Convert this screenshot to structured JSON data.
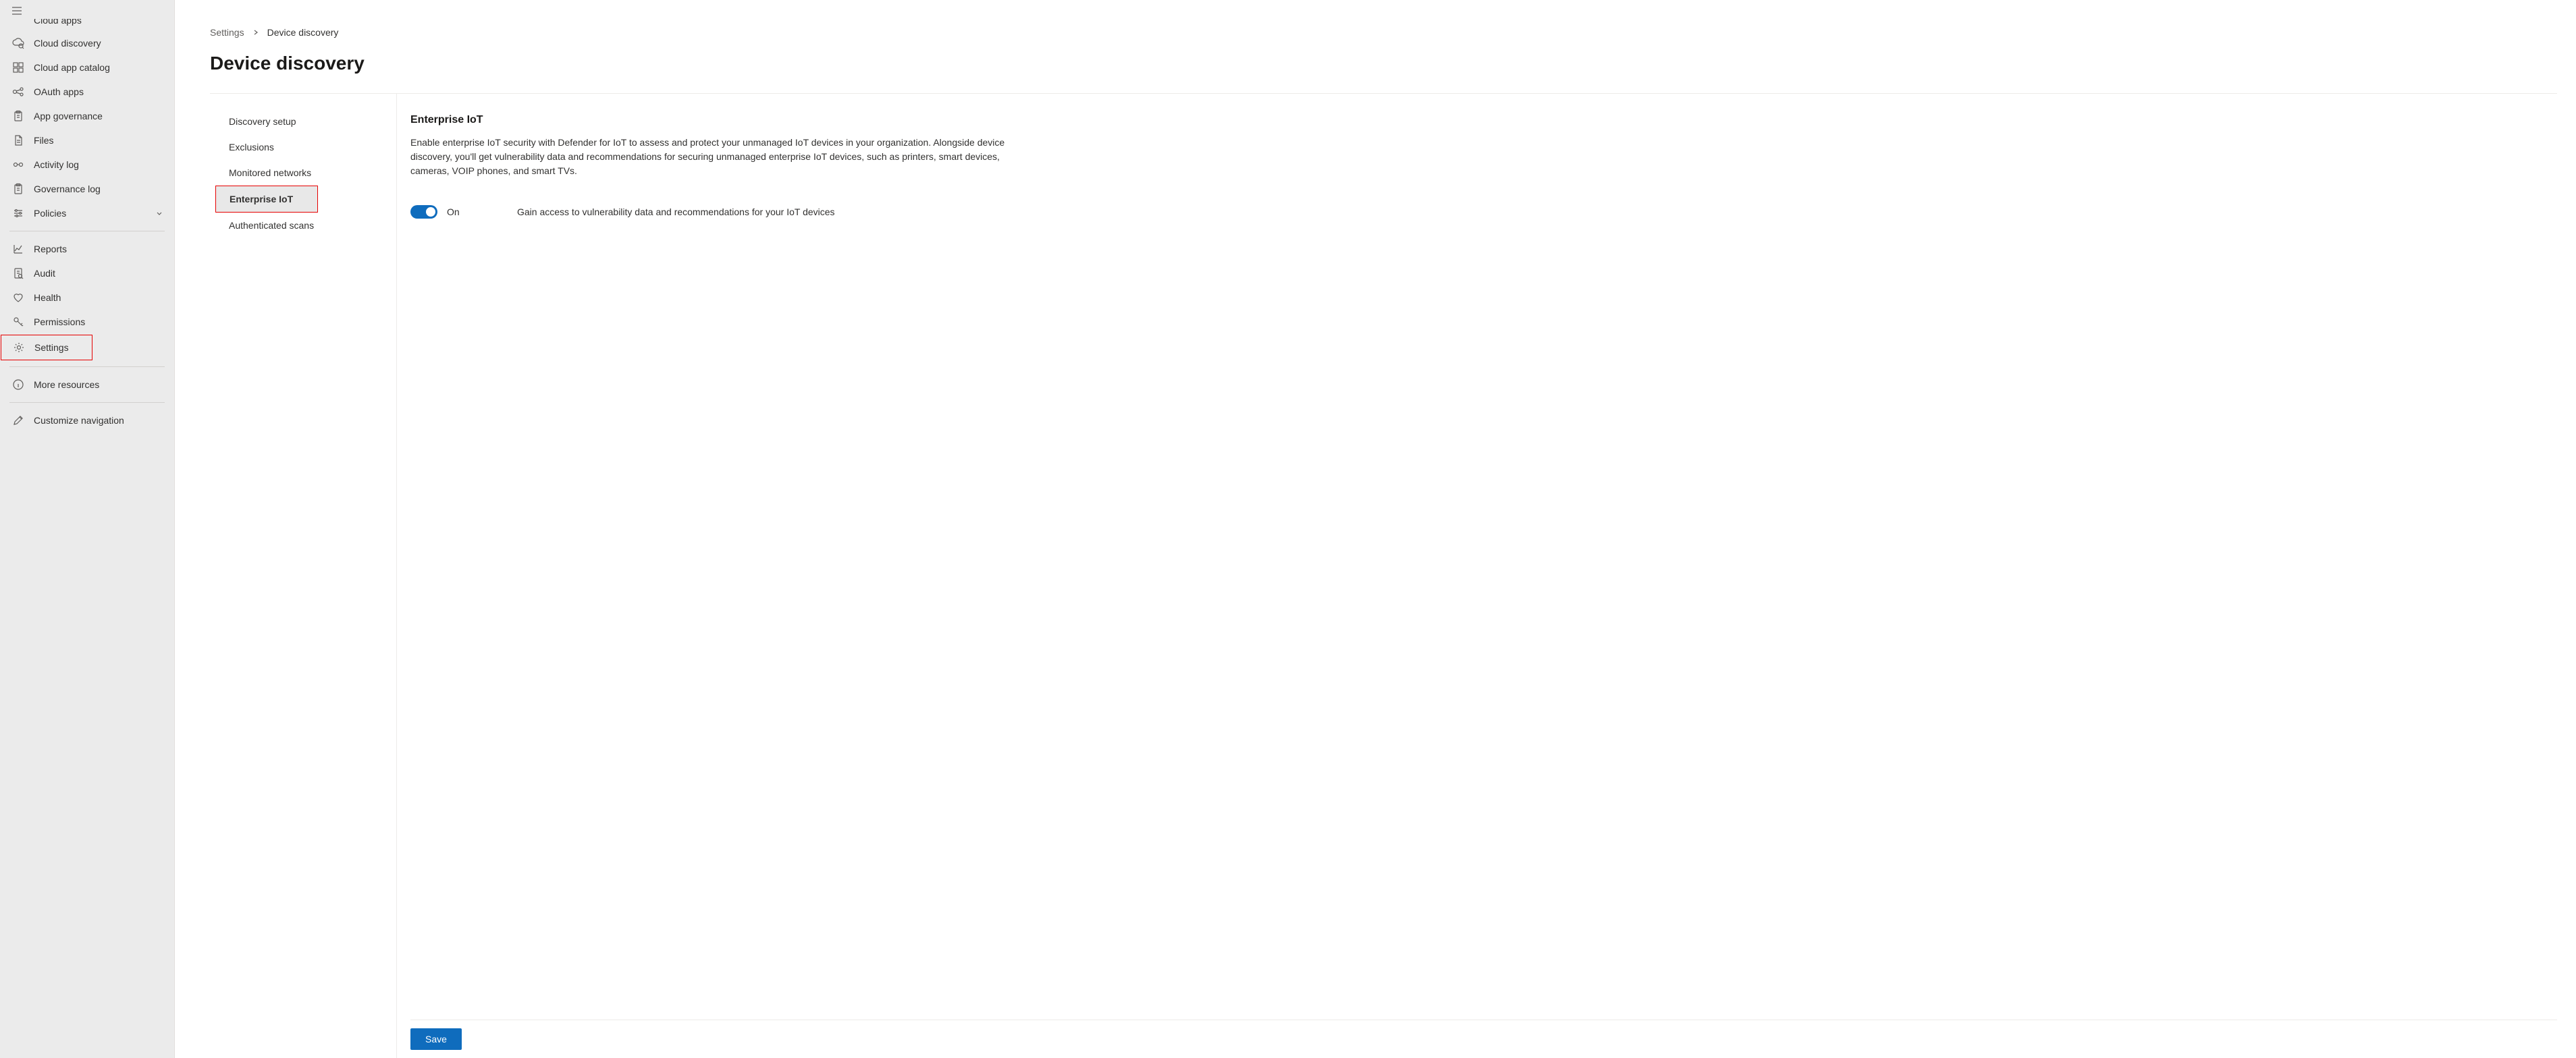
{
  "sidebar": {
    "items": [
      {
        "icon": "cloud-apps",
        "label": "Cloud apps"
      },
      {
        "icon": "cloud-discovery",
        "label": "Cloud discovery"
      },
      {
        "icon": "app-catalog",
        "label": "Cloud app catalog"
      },
      {
        "icon": "oauth",
        "label": "OAuth apps"
      },
      {
        "icon": "clipboard",
        "label": "App governance"
      },
      {
        "icon": "files",
        "label": "Files"
      },
      {
        "icon": "activity",
        "label": "Activity log"
      },
      {
        "icon": "clipboard",
        "label": "Governance log"
      },
      {
        "icon": "sliders",
        "label": "Policies",
        "chevron": true
      }
    ],
    "items2": [
      {
        "icon": "chart",
        "label": "Reports"
      },
      {
        "icon": "audit",
        "label": "Audit"
      },
      {
        "icon": "heart",
        "label": "Health"
      },
      {
        "icon": "key",
        "label": "Permissions"
      },
      {
        "icon": "gear",
        "label": "Settings",
        "highlight": true
      }
    ],
    "items3": [
      {
        "icon": "info",
        "label": "More resources"
      }
    ],
    "items4": [
      {
        "icon": "pencil",
        "label": "Customize navigation"
      }
    ]
  },
  "breadcrumb": {
    "root": "Settings",
    "current": "Device discovery"
  },
  "page": {
    "title": "Device discovery"
  },
  "subnav": {
    "items": [
      {
        "label": "Discovery setup"
      },
      {
        "label": "Exclusions"
      },
      {
        "label": "Monitored networks"
      },
      {
        "label": "Enterprise IoT"
      },
      {
        "label": "Authenticated scans"
      }
    ]
  },
  "detail": {
    "title": "Enterprise IoT",
    "description": "Enable enterprise IoT security with Defender for IoT to assess and protect your unmanaged IoT devices in your organization. Alongside device discovery, you'll get vulnerability data and recommendations for securing unmanaged enterprise IoT devices, such as printers, smart devices, cameras, VOIP phones, and smart TVs.",
    "toggle_state": "On",
    "toggle_desc": "Gain access to vulnerability data and recommendations for your IoT devices",
    "save_label": "Save"
  }
}
